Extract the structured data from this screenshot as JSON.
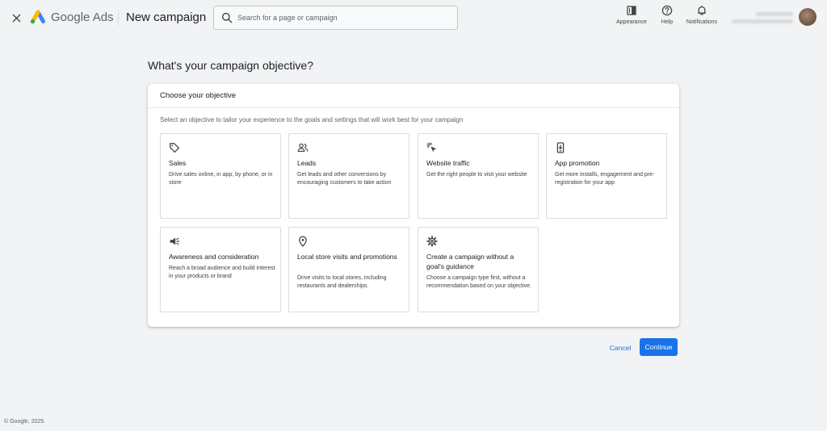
{
  "header": {
    "brand": "Google Ads",
    "title": "New campaign",
    "search": {
      "placeholder": "Search for a page or campaign"
    },
    "actions": {
      "appearance": "Appearance",
      "help": "Help",
      "notifications": "Notifications"
    },
    "icons": {
      "close": "close-icon",
      "logo": "google-ads-logo",
      "search": "search-icon",
      "appearance": "appearance-icon",
      "help": "help-icon",
      "notifications": "bell-icon"
    }
  },
  "main": {
    "question": "What's your campaign objective?",
    "card": {
      "title": "Choose your objective",
      "subtitle": "Select an objective to tailor your experience to the goals and settings that will work best for your campaign",
      "options": [
        {
          "icon": "tag-icon",
          "title": "Sales",
          "description": "Drive sales online, in app, by phone, or in store"
        },
        {
          "icon": "people-icon",
          "title": "Leads",
          "description": "Get leads and other conversions by encouraging customers to take action"
        },
        {
          "icon": "cursor-click-icon",
          "title": "Website traffic",
          "description": "Get the right people to visit your website"
        },
        {
          "icon": "phone-download-icon",
          "title": "App promotion",
          "description": "Get more installs, engagement and pre-registration for your app"
        },
        {
          "icon": "megaphone-icon",
          "title": "Awareness and consideration",
          "description": "Reach a broad audience and build interest in your products or brand"
        },
        {
          "icon": "location-pin-icon",
          "title": "Local store visits and promotions",
          "description": "Drive visits to local stores, including restaurants and dealerships."
        },
        {
          "icon": "gear-icon",
          "title": "Create a campaign without a goal's guidance",
          "description": "Choose a campaign type first, without a recommendation based on your objective."
        }
      ]
    },
    "buttons": {
      "cancel": "Cancel",
      "continue": "Continue"
    }
  },
  "footer": {
    "copyright": "© Google, 2025."
  },
  "colors": {
    "page_background": "#f1f3f4",
    "primary_blue": "#1a73e8",
    "card_background": "#ffffff",
    "border": "#dadce0",
    "logo_blue": "#4285f4",
    "logo_yellow": "#fbbc04",
    "logo_green": "#34a853"
  }
}
